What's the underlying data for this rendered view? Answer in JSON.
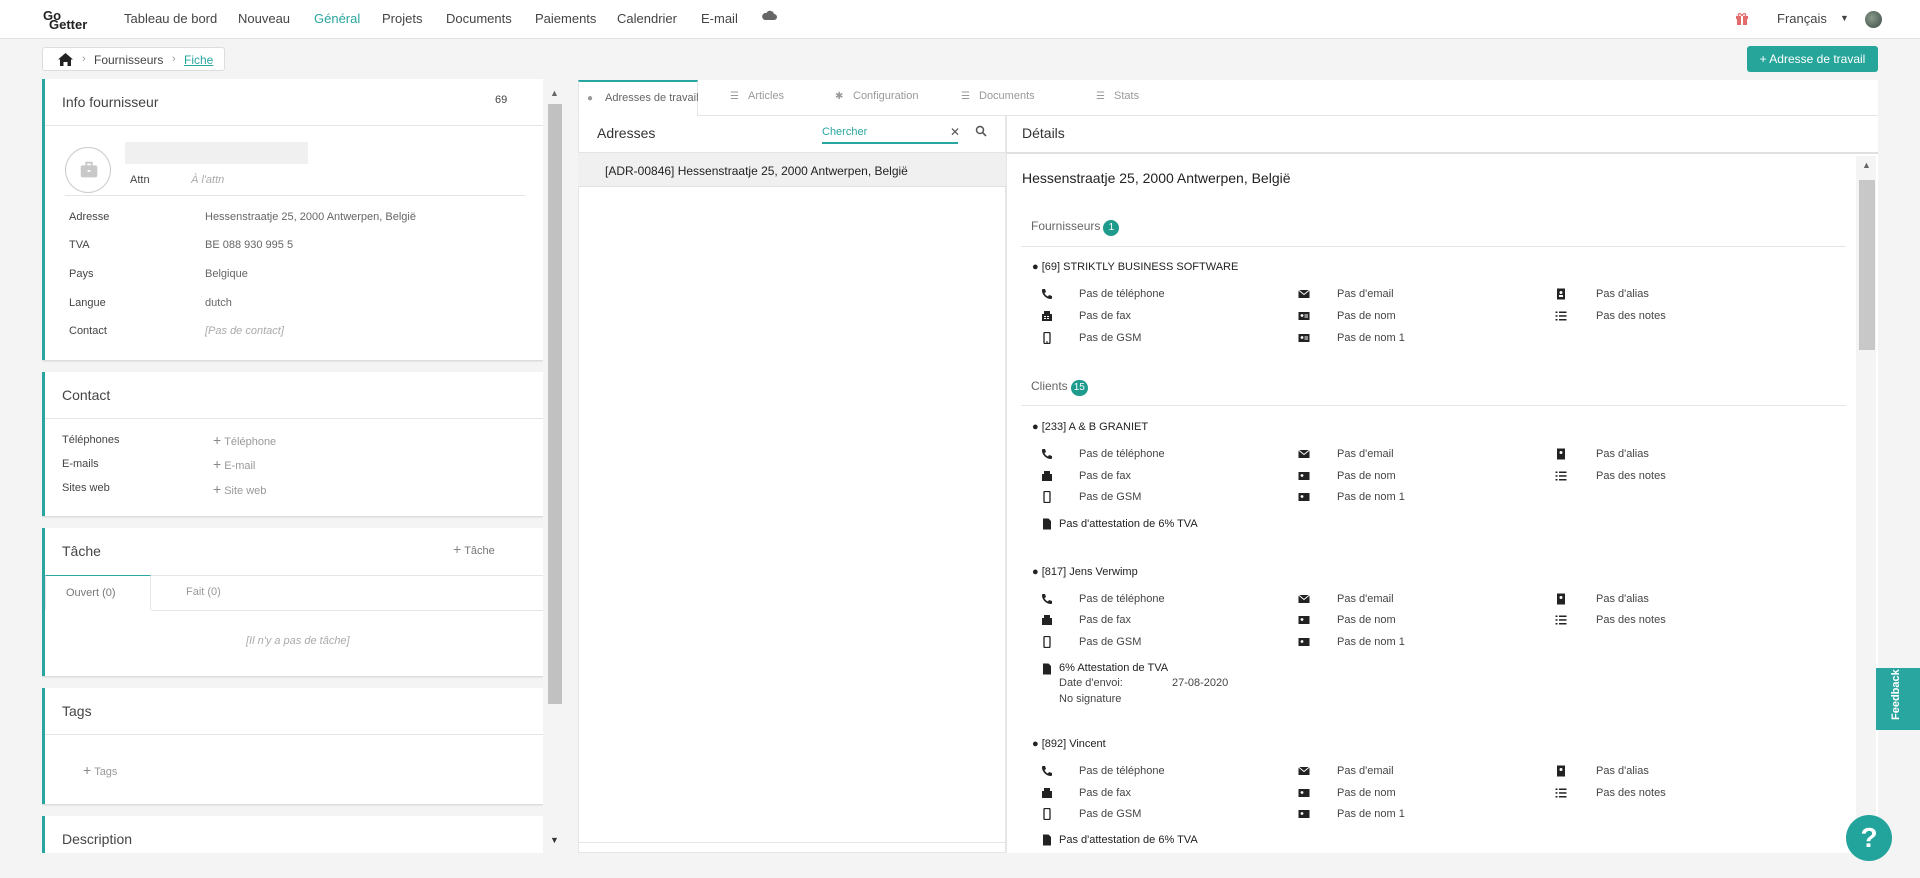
{
  "nav": {
    "logo_top": "Go",
    "logo_bottom": "Getter",
    "items": [
      "Tableau de bord",
      "Nouveau",
      "Général",
      "Projets",
      "Documents",
      "Paiements",
      "Calendrier",
      "E-mail"
    ],
    "language": "Français"
  },
  "breadcrumb": {
    "item1": "Fournisseurs",
    "item2": "Fiche"
  },
  "actions": {
    "add_address": "+ Adresse de travail"
  },
  "info": {
    "title": "Info fournisseur",
    "id": "69",
    "attn_label": "Attn",
    "attn_value": "À l'attn",
    "rows": [
      {
        "label": "Adresse",
        "value": "Hessenstraatje 25, 2000 Antwerpen, België"
      },
      {
        "label": "TVA",
        "value": "BE 088 930 995 5"
      },
      {
        "label": "Pays",
        "value": "Belgique"
      },
      {
        "label": "Langue",
        "value": "dutch"
      },
      {
        "label": "Contact",
        "value": "[Pas de contact]"
      }
    ]
  },
  "contact": {
    "title": "Contact",
    "rows": [
      {
        "label": "Téléphones",
        "action": "Téléphone"
      },
      {
        "label": "E-mails",
        "action": "E-mail"
      },
      {
        "label": "Sites web",
        "action": "Site web"
      }
    ]
  },
  "task": {
    "title": "Tâche",
    "add": "Tâche",
    "tab_open": "Ouvert (0)",
    "tab_done": "Fait (0)",
    "empty": "[Il n'y a pas de tâche]"
  },
  "tags": {
    "title": "Tags",
    "add": "Tags"
  },
  "description": {
    "title": "Description"
  },
  "tabs": [
    "Adresses de travail",
    "Articles",
    "Configuration",
    "Documents",
    "Stats"
  ],
  "addresses": {
    "title": "Adresses",
    "search_placeholder": "Chercher",
    "items": [
      "[ADR-00846] Hessenstraatje 25, 2000 Antwerpen, België"
    ]
  },
  "details": {
    "title": "Détails",
    "address": "Hessenstraatje 25, 2000 Antwerpen, België",
    "suppliers_title": "Fournisseurs",
    "suppliers_count": "1",
    "clients_title": "Clients",
    "clients_count": "15",
    "no_phone": "Pas de téléphone",
    "no_fax": "Pas de fax",
    "no_gsm": "Pas de GSM",
    "no_email": "Pas d'email",
    "no_name": "Pas de nom",
    "no_name1": "Pas de nom 1",
    "no_alias": "Pas d'alias",
    "no_notes": "Pas des notes",
    "no_attest": "Pas d'attestation de 6% TVA",
    "supplier_name": "● [69] STRIKTLY BUSINESS SOFTWARE",
    "client1": "● [233] A & B GRANIET",
    "client2": "● [817] Jens Verwimp",
    "client2_attest": "6% Attestation de TVA",
    "client2_date_label": "Date d'envoi:",
    "client2_date": "27-08-2020",
    "client2_sig": "No signature",
    "client3": "● [892] Vincent"
  },
  "feedback": "Feedback",
  "help": "?"
}
